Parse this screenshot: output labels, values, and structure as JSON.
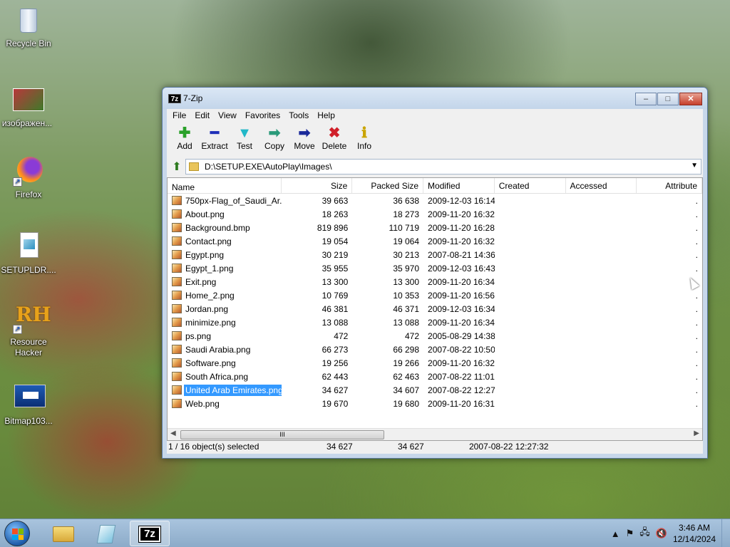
{
  "desktop": {
    "icons": [
      {
        "label": "Recycle Bin",
        "icon": "recycle-bin-icon"
      },
      {
        "label": "изображен...",
        "icon": "image-icon"
      },
      {
        "label": "Firefox",
        "icon": "firefox-icon"
      },
      {
        "label": "SETUPLDR....",
        "icon": "file-icon"
      },
      {
        "label": "Resource Hacker",
        "icon": "resource-hacker-icon",
        "logo_text": "RH"
      },
      {
        "label": "Bitmap103...",
        "icon": "bitmap-icon"
      }
    ]
  },
  "window": {
    "app_icon_text": "7z",
    "title": "7-Zip",
    "buttons": {
      "minimize": "–",
      "maximize": "□",
      "close": "✕"
    },
    "menu": [
      "File",
      "Edit",
      "View",
      "Favorites",
      "Tools",
      "Help"
    ],
    "toolbar": [
      {
        "label": "Add",
        "glyph": "✚",
        "color": "#2aa12a",
        "icon": "add-icon"
      },
      {
        "label": "Extract",
        "glyph": "━",
        "color": "#1e2fb8",
        "icon": "extract-icon"
      },
      {
        "label": "Test",
        "glyph": "▼",
        "color": "#22b8c8",
        "icon": "test-icon"
      },
      {
        "label": "Copy",
        "glyph": "➡",
        "color": "#2a9a7a",
        "icon": "copy-icon"
      },
      {
        "label": "Move",
        "glyph": "➡",
        "color": "#1a2a9a",
        "icon": "move-icon"
      },
      {
        "label": "Delete",
        "glyph": "✖",
        "color": "#d0202a",
        "icon": "delete-icon"
      },
      {
        "label": "Info",
        "glyph": "ℹ",
        "color": "#c9a400",
        "icon": "info-icon"
      }
    ],
    "address": "D:\\SETUP.EXE\\AutoPlay\\Images\\",
    "columns": [
      "Name",
      "Size",
      "Packed Size",
      "Modified",
      "Created",
      "Accessed",
      "Attribute"
    ],
    "files": [
      {
        "name": "750px-Flag_of_Saudi_Ar...",
        "size": "39 663",
        "packed": "36 638",
        "modified": "2009-12-03 16:14"
      },
      {
        "name": "About.png",
        "size": "18 263",
        "packed": "18 273",
        "modified": "2009-11-20 16:32"
      },
      {
        "name": "Background.bmp",
        "size": "819 896",
        "packed": "110 719",
        "modified": "2009-11-20 16:28"
      },
      {
        "name": "Contact.png",
        "size": "19 054",
        "packed": "19 064",
        "modified": "2009-11-20 16:32"
      },
      {
        "name": "Egypt.png",
        "size": "30 219",
        "packed": "30 213",
        "modified": "2007-08-21 14:36"
      },
      {
        "name": "Egypt_1.png",
        "size": "35 955",
        "packed": "35 970",
        "modified": "2009-12-03 16:43"
      },
      {
        "name": "Exit.png",
        "size": "13 300",
        "packed": "13 300",
        "modified": "2009-11-20 16:34"
      },
      {
        "name": "Home_2.png",
        "size": "10 769",
        "packed": "10 353",
        "modified": "2009-11-20 16:56"
      },
      {
        "name": "Jordan.png",
        "size": "46 381",
        "packed": "46 371",
        "modified": "2009-12-03 16:34"
      },
      {
        "name": "minimize.png",
        "size": "13 088",
        "packed": "13 088",
        "modified": "2009-11-20 16:34"
      },
      {
        "name": "ps.png",
        "size": "472",
        "packed": "472",
        "modified": "2005-08-29 14:38"
      },
      {
        "name": "Saudi Arabia.png",
        "size": "66 273",
        "packed": "66 298",
        "modified": "2007-08-22 10:50"
      },
      {
        "name": "Software.png",
        "size": "19 256",
        "packed": "19 266",
        "modified": "2009-11-20 16:32"
      },
      {
        "name": "South Africa.png",
        "size": "62 443",
        "packed": "62 463",
        "modified": "2007-08-22 11:01"
      },
      {
        "name": "United Arab Emirates.png",
        "size": "34 627",
        "packed": "34 607",
        "modified": "2007-08-22 12:27",
        "selected": true
      },
      {
        "name": "Web.png",
        "size": "19 670",
        "packed": "19 680",
        "modified": "2009-11-20 16:31"
      }
    ],
    "status": {
      "selection": "1 / 16 object(s) selected",
      "size": "34 627",
      "packed": "34 627",
      "modified": "2007-08-22 12:27:32"
    },
    "scroll_grip": "III"
  },
  "taskbar": {
    "app_icon_text": "7z",
    "tray": {
      "time": "3:46 AM",
      "date": "12/14/2024"
    }
  },
  "colors": {
    "selection": "#3399ff",
    "close_button": "#c6402c"
  }
}
